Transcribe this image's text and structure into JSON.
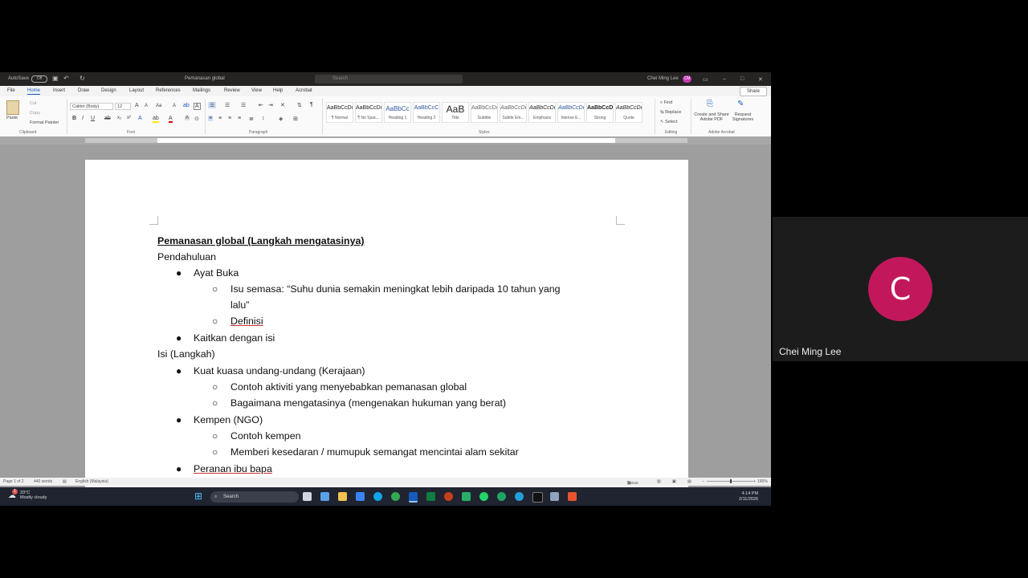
{
  "word": {
    "titlebar": {
      "autosave_label": "AutoSave",
      "autosave_state": "Off",
      "doc_title": "Pemanasan global",
      "search_placeholder": "Search",
      "user_name": "Chei Ming Lee",
      "user_initials": "CM"
    },
    "tabs": [
      "File",
      "Home",
      "Insert",
      "Draw",
      "Design",
      "Layout",
      "References",
      "Mailings",
      "Review",
      "View",
      "Help",
      "Acrobat"
    ],
    "active_tab": "Home",
    "share_label": "Share",
    "ribbon": {
      "clipboard": {
        "paste": "Paste",
        "cut": "Cut",
        "copy": "Copy",
        "format_painter": "Format Painter",
        "label": "Clipboard"
      },
      "font": {
        "name": "Calibri (Body)",
        "size": "12",
        "label": "Font"
      },
      "paragraph_label": "Paragraph",
      "styles_label": "Styles",
      "styles": [
        {
          "sample": "AaBbCcDc",
          "name": "¶ Normal"
        },
        {
          "sample": "AaBbCcDc",
          "name": "¶ No Spac..."
        },
        {
          "sample": "AaBbCc",
          "name": "Heading 1"
        },
        {
          "sample": "AaBbCcC",
          "name": "Heading 2"
        },
        {
          "sample": "AaB",
          "name": "Title"
        },
        {
          "sample": "AaBbCcDc",
          "name": "Subtitle"
        },
        {
          "sample": "AaBbCcDc",
          "name": "Subtle Em..."
        },
        {
          "sample": "AaBbCcDc",
          "name": "Emphasis"
        },
        {
          "sample": "AaBbCcDc",
          "name": "Intense E..."
        },
        {
          "sample": "AaBbCcDc",
          "name": "Strong"
        },
        {
          "sample": "AaBbCcDc",
          "name": "Quote"
        }
      ],
      "editing": {
        "find": "Find",
        "replace": "Replace",
        "select": "Select",
        "label": "Editing"
      },
      "acrobat": {
        "create_share": "Create and Share Adobe PDF",
        "request_sig": "Request Signatures",
        "label": "Adobe Acrobat"
      }
    },
    "document": {
      "title": "Pemanasan global (Langkah mengatasinya)",
      "lines": {
        "l1": "Pendahuluan",
        "l2": "Ayat Buka",
        "l3a": "Isu semasa: “Suhu dunia semakin meningkat lebih daripada 10 tahun yang",
        "l3b": "lalu”",
        "l4": "Definisi",
        "l5": "Kaitkan dengan isi",
        "l6": "Isi (Langkah)",
        "l7": "Kuat kuasa undang-undang (Kerajaan)",
        "l8": "Contoh aktiviti yang menyebabkan pemanasan global",
        "l9": "Bagaimana mengatasinya (mengenakan hukuman yang berat)",
        "l10": "Kempen (NGO)",
        "l11": "Contoh kempen",
        "l12": "Memberi kesedaran / mumupuk semangat mencintai alam sekitar",
        "l13": "Peranan ibu bapa"
      }
    },
    "statusbar": {
      "page": "Page 1 of 2",
      "words": "440 words",
      "language": "English (Malaysia)",
      "focus": "Focus",
      "zoom": "190%"
    }
  },
  "taskbar": {
    "weather_temp": "33°C",
    "weather_desc": "Mostly cloudy",
    "weather_badge": "1",
    "search_label": "Search",
    "time": "4:14 PM",
    "date": "2/11/2026"
  },
  "participant": {
    "initial": "C",
    "name": "Chei Ming Lee"
  },
  "colors": {
    "avatar": "#c2185b",
    "word_blue": "#185abd"
  }
}
